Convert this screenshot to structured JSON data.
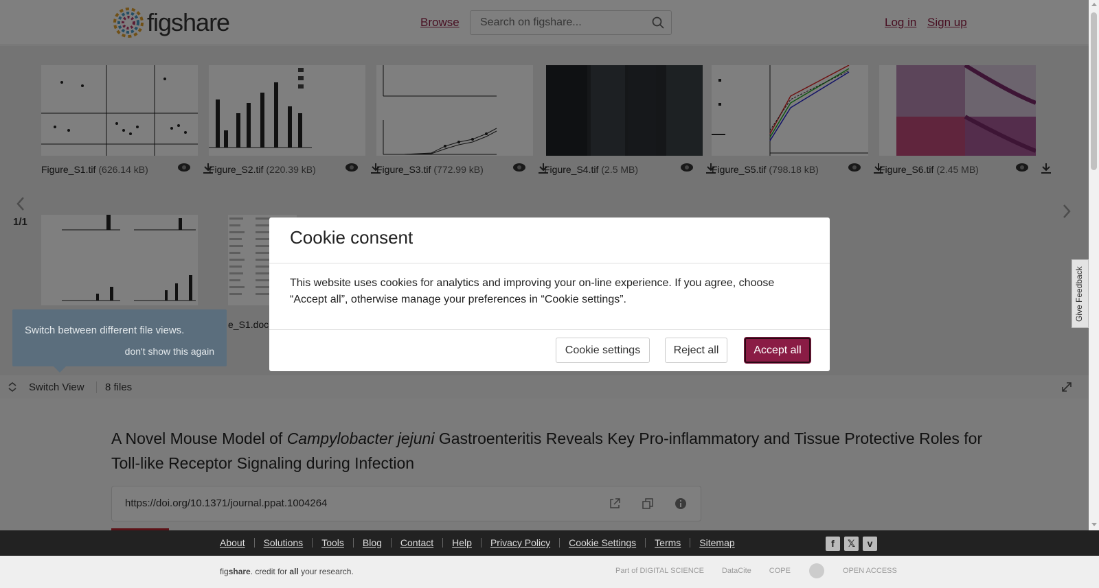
{
  "header": {
    "logo_text": "figshare",
    "browse_label": "Browse",
    "search_placeholder": "Search on figshare...",
    "login_label": "Log in",
    "signup_label": "Sign up"
  },
  "viewer": {
    "files": [
      {
        "name": "Figure_S1.tif",
        "size": "(626.14 kB)"
      },
      {
        "name": "Figure_S2.tif",
        "size": "(220.39 kB)"
      },
      {
        "name": "Figure_S3.tif",
        "size": "(772.99 kB)"
      },
      {
        "name": "Figure_S4.tif",
        "size": "(2.5 MB)"
      },
      {
        "name": "Figure_S5.tif",
        "size": "(798.18 kB)"
      },
      {
        "name": "Figure_S6.tif",
        "size": "(2.45 MB)"
      },
      {
        "name": "",
        "size": ""
      },
      {
        "name": "e_S1.doc",
        "size": ""
      }
    ],
    "pager": "1/1",
    "tooltip_text": "Switch between different file views.",
    "tooltip_link": "don't show this again",
    "switch_view_label": "Switch View",
    "file_count": "8 files"
  },
  "article": {
    "title_pre": "A Novel Mouse Model of ",
    "title_italic": "Campylobacter jejuni",
    "title_post": " Gastroenteritis Reveals Key Pro-inflammatory and Tissue Protective Roles for Toll-like Receptor Signaling during Infection",
    "doi": "https://doi.org/10.1371/journal.ppat.1004264"
  },
  "feedback_label": "Give Feedback",
  "cookie_modal": {
    "title": "Cookie consent",
    "body": "This website uses cookies for analytics and improving your on-line experience. If you agree, choose “Accept all”, otherwise manage your preferences in “Cookie settings”.",
    "settings_label": "Cookie settings",
    "reject_label": "Reject all",
    "accept_label": "Accept all"
  },
  "footer": {
    "links": [
      "About",
      "Solutions",
      "Tools",
      "Blog",
      "Contact",
      "Help",
      "Privacy Policy",
      "Cookie Settings",
      "Terms",
      "Sitemap"
    ],
    "credit_brand_a": "fig",
    "credit_brand_b": "share",
    "credit_mid": ". credit for ",
    "credit_all": "all",
    "credit_end": " your research.",
    "partners": [
      "Part of DIGITAL SCIENCE",
      "DataCite",
      "COPE",
      "",
      "OPEN ACCESS"
    ]
  },
  "colors": {
    "brand": "#8a1c45",
    "link": "#8f1d42",
    "footer_dark": "#222222"
  }
}
